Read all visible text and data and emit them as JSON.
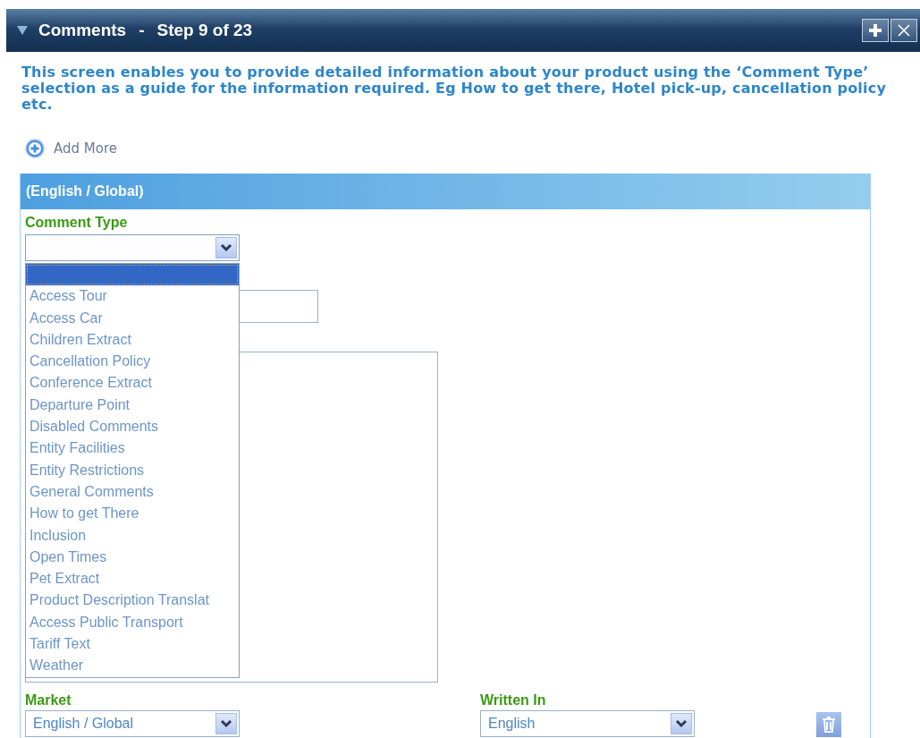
{
  "header": {
    "title": "Comments",
    "separator": "-",
    "step": "Step 9 of 23"
  },
  "description": "This screen enables you to provide detailed information about your product using the ‘Comment Type’ selection as a guide for the information required. Eg How to get there, Hotel pick-up, cancellation policy etc.",
  "add_more": "Add More",
  "panel": {
    "title": "(English / Global)",
    "comment_type": {
      "label": "Comment Type",
      "expanded": true,
      "options": [
        {
          "selected": true
        },
        {
          "label": "Access Tour",
          "selected": false
        },
        {
          "label": "Access Car",
          "selected": false
        },
        {
          "label": "Children Extract",
          "selected": false
        },
        {
          "label": "Cancellation Policy",
          "selected": false
        },
        {
          "label": "Conference Extract",
          "selected": false
        },
        {
          "label": "Departure Point",
          "selected": false
        },
        {
          "label": "Disabled Comments",
          "selected": false
        },
        {
          "label": "Entity Facilities",
          "selected": false
        },
        {
          "label": "Entity Restrictions",
          "selected": false
        },
        {
          "label": "General Comments",
          "selected": false
        },
        {
          "label": "How to get There",
          "selected": false
        },
        {
          "label": "Inclusion",
          "selected": false
        },
        {
          "label": "Open Times",
          "selected": false
        },
        {
          "label": "Pet Extract",
          "selected": false
        },
        {
          "label": "Product Description Translat",
          "selected": false
        },
        {
          "label": "Access Public Transport",
          "selected": false
        },
        {
          "label": "Tariff Text",
          "selected": false
        },
        {
          "label": "Weather",
          "selected": false
        }
      ]
    },
    "market": {
      "label": "Market",
      "value": "English / Global"
    },
    "written_in": {
      "label": "Written In",
      "value": "English"
    }
  }
}
